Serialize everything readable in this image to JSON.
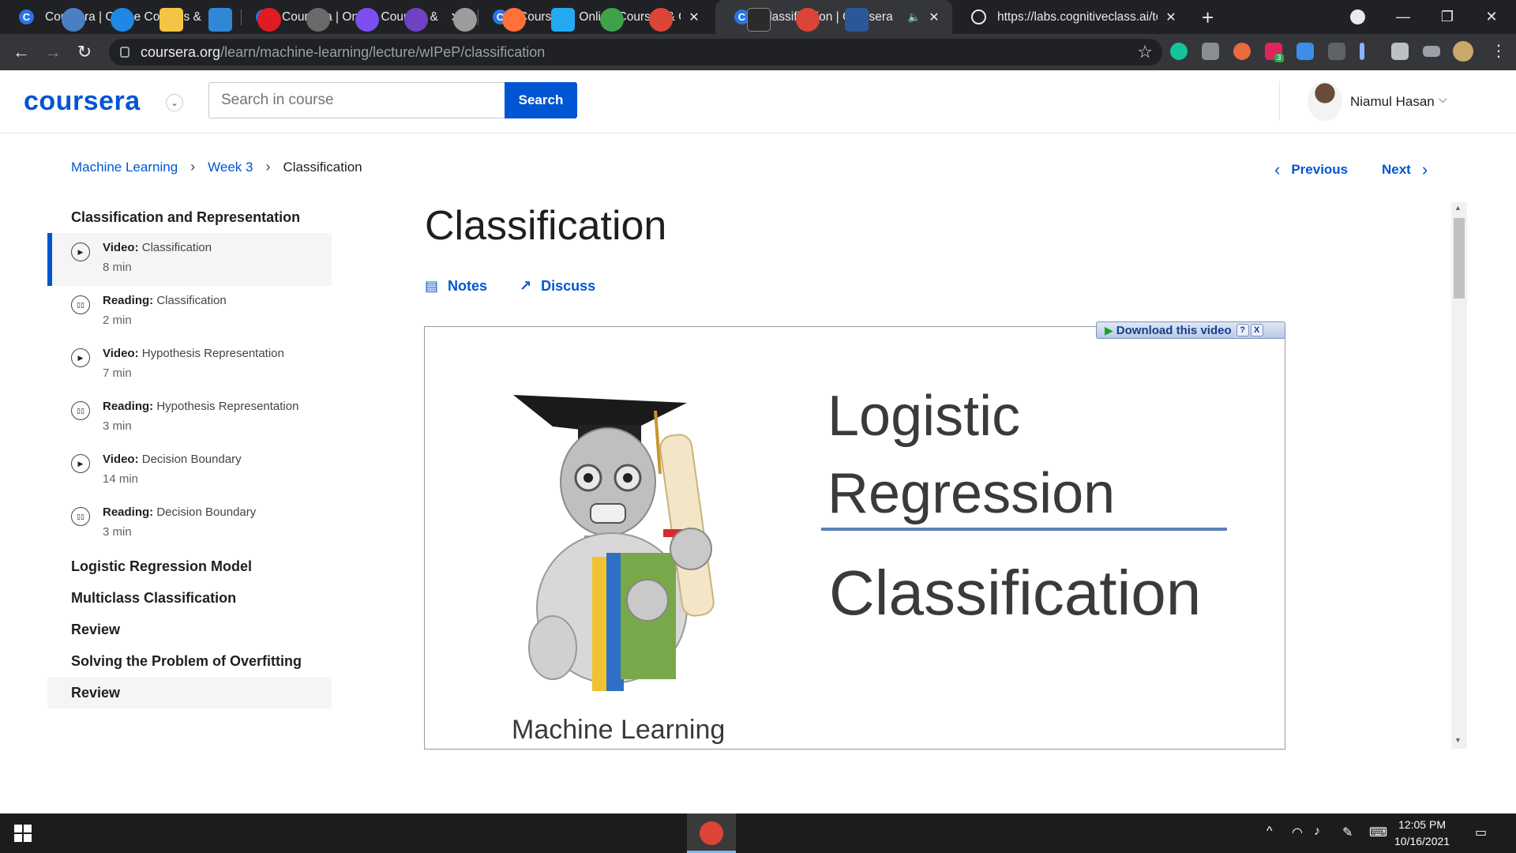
{
  "browser": {
    "tabs": [
      {
        "title": "Coursera | Online Courses & Crec",
        "favicon": "C",
        "active": false
      },
      {
        "title": "Coursera | Online Courses & Crec",
        "favicon": "C",
        "active": false
      },
      {
        "title": "Coursera | Online Courses & Crec",
        "favicon": "C",
        "active": false
      },
      {
        "title": "Classification | Coursera",
        "favicon": "C",
        "active": true,
        "audio": true
      },
      {
        "title": "https://labs.cognitiveclass.ai/tool",
        "favicon": "globe",
        "active": false
      }
    ],
    "url_host": "coursera.org",
    "url_path": "/learn/machine-learning/lecture/wIPeP/classification",
    "extension_badge": "3"
  },
  "header": {
    "logo": "coursera",
    "search_placeholder": "Search in course",
    "search_button": "Search",
    "user_name": "Niamul Hasan"
  },
  "breadcrumb": {
    "items": [
      "Machine Learning",
      "Week 3",
      "Classification"
    ]
  },
  "nav": {
    "previous": "Previous",
    "next": "Next"
  },
  "sidebar": {
    "section_title": "Classification and Representation",
    "items": [
      {
        "kind": "Video:",
        "title": "Classification",
        "duration": "8 min",
        "icon": "play-icon",
        "active": true
      },
      {
        "kind": "Reading:",
        "title": "Classification",
        "duration": "2 min",
        "icon": "book-icon",
        "active": false
      },
      {
        "kind": "Video:",
        "title": "Hypothesis Representation",
        "duration": "7 min",
        "icon": "play-icon",
        "active": false
      },
      {
        "kind": "Reading:",
        "title": "Hypothesis Representation",
        "duration": "3 min",
        "icon": "book-icon",
        "active": false
      },
      {
        "kind": "Video:",
        "title": "Decision Boundary",
        "duration": "14 min",
        "icon": "play-icon",
        "active": false
      },
      {
        "kind": "Reading:",
        "title": "Decision Boundary",
        "duration": "3 min",
        "icon": "book-icon",
        "active": false
      }
    ],
    "modules": [
      "Logistic Regression Model",
      "Multiclass Classification",
      "Review",
      "Solving the Problem of Overfitting",
      "Review"
    ]
  },
  "main": {
    "title": "Classification",
    "notes_label": "Notes",
    "discuss_label": "Discuss",
    "download_label": "Download this video",
    "download_help": "?",
    "download_close": "X",
    "slide": {
      "line1": "Logistic",
      "line2": "Regression",
      "line3": "Classification",
      "caption": "Machine Learning"
    }
  },
  "taskbar": {
    "time": "12:05 PM",
    "date": "10/16/2021"
  },
  "colors": {
    "brand_blue": "#0056d2",
    "tabstrip": "#202124",
    "toolbar": "#35363a"
  }
}
